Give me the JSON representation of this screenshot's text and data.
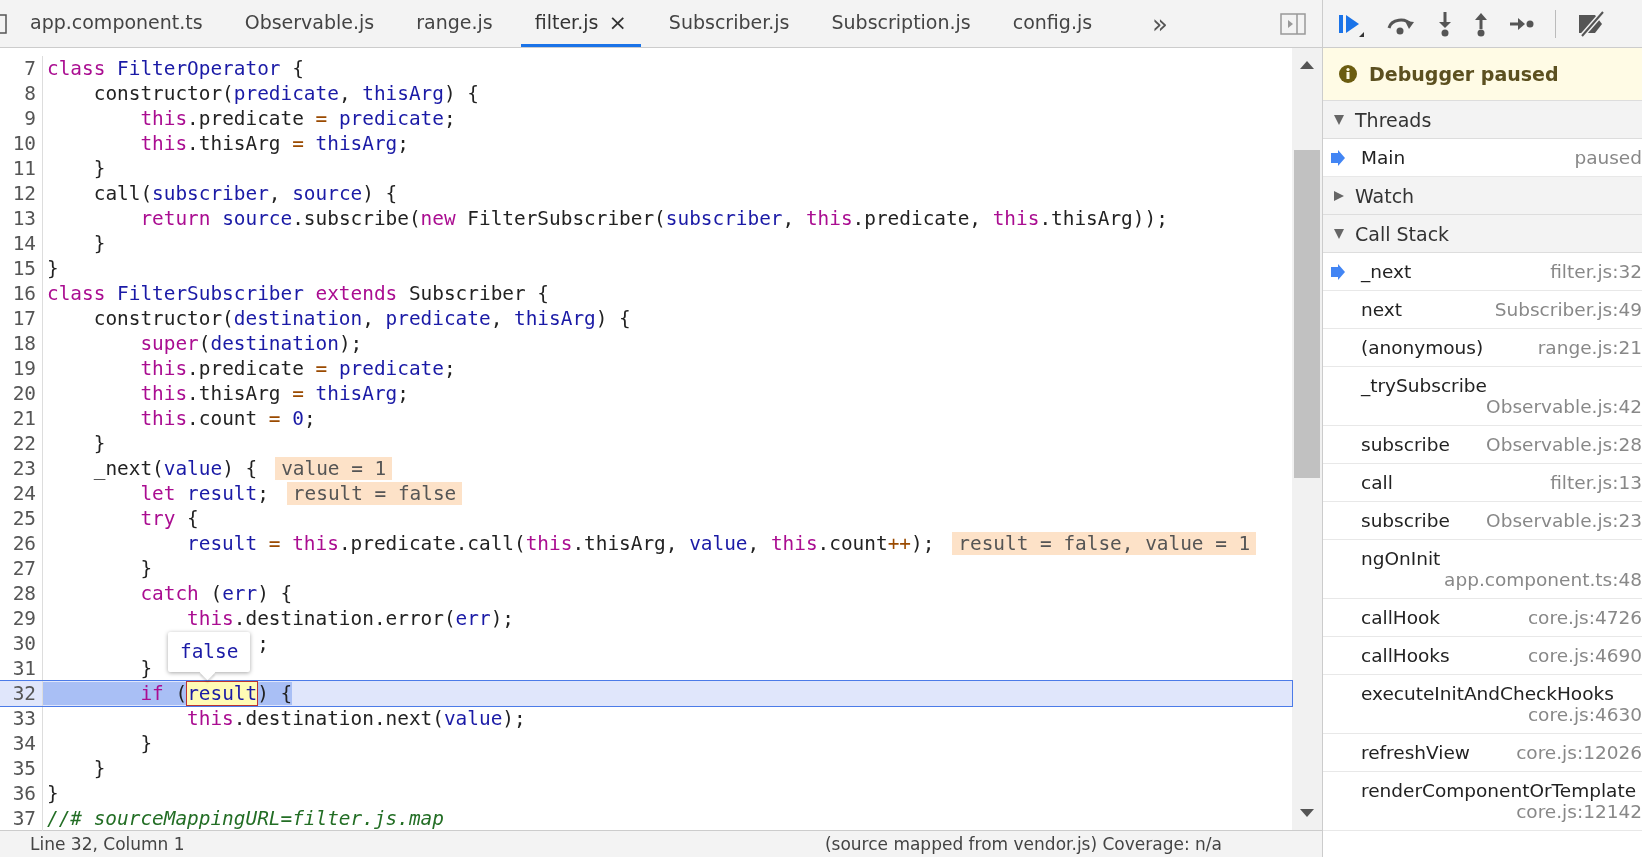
{
  "tabs": [
    {
      "label": "app.component.ts",
      "selected": false
    },
    {
      "label": "Observable.js",
      "selected": false
    },
    {
      "label": "range.js",
      "selected": false
    },
    {
      "label": "filter.js",
      "selected": true,
      "close": "×"
    },
    {
      "label": "Subscriber.js",
      "selected": false
    },
    {
      "label": "Subscription.js",
      "selected": false
    },
    {
      "label": "config.js",
      "selected": false
    }
  ],
  "more_tabs": "»",
  "code": {
    "lines": [
      {
        "number": "7",
        "paused": false,
        "tokens": [
          {
            "kind": "kw",
            "text": "class "
          },
          {
            "kind": "def",
            "text": "FilterOperator"
          },
          {
            "kind": "p",
            "text": " {"
          }
        ]
      },
      {
        "number": "8",
        "paused": false,
        "tokens": [
          {
            "kind": "p",
            "text": "    constructor("
          },
          {
            "kind": "v",
            "text": "predicate"
          },
          {
            "kind": "p",
            "text": ", "
          },
          {
            "kind": "v",
            "text": "thisArg"
          },
          {
            "kind": "p",
            "text": ") {"
          }
        ]
      },
      {
        "number": "9",
        "paused": false,
        "tokens": [
          {
            "kind": "kw",
            "text": "        this"
          },
          {
            "kind": "p",
            "text": ".predicate "
          },
          {
            "kind": "op",
            "text": "="
          },
          {
            "kind": "v",
            "text": " predicate"
          },
          {
            "kind": "p",
            "text": ";"
          }
        ]
      },
      {
        "number": "10",
        "paused": false,
        "tokens": [
          {
            "kind": "kw",
            "text": "        this"
          },
          {
            "kind": "p",
            "text": ".thisArg "
          },
          {
            "kind": "op",
            "text": "="
          },
          {
            "kind": "v",
            "text": " thisArg"
          },
          {
            "kind": "p",
            "text": ";"
          }
        ]
      },
      {
        "number": "11",
        "paused": false,
        "tokens": [
          {
            "kind": "p",
            "text": "    }"
          }
        ]
      },
      {
        "number": "12",
        "paused": false,
        "tokens": [
          {
            "kind": "p",
            "text": "    call("
          },
          {
            "kind": "v",
            "text": "subscriber"
          },
          {
            "kind": "p",
            "text": ", "
          },
          {
            "kind": "v",
            "text": "source"
          },
          {
            "kind": "p",
            "text": ") {"
          }
        ]
      },
      {
        "number": "13",
        "paused": false,
        "tokens": [
          {
            "kind": "kw",
            "text": "        return"
          },
          {
            "kind": "v",
            "text": " source"
          },
          {
            "kind": "p",
            "text": ".subscribe("
          },
          {
            "kind": "kw",
            "text": "new"
          },
          {
            "kind": "p",
            "text": " FilterSubscriber("
          },
          {
            "kind": "v",
            "text": "subscriber"
          },
          {
            "kind": "p",
            "text": ", "
          },
          {
            "kind": "kw",
            "text": "this"
          },
          {
            "kind": "p",
            "text": ".predicate, "
          },
          {
            "kind": "kw",
            "text": "this"
          },
          {
            "kind": "p",
            "text": ".thisArg));"
          }
        ]
      },
      {
        "number": "14",
        "paused": false,
        "tokens": [
          {
            "kind": "p",
            "text": "    }"
          }
        ]
      },
      {
        "number": "15",
        "paused": false,
        "tokens": [
          {
            "kind": "p",
            "text": "}"
          }
        ]
      },
      {
        "number": "16",
        "paused": false,
        "tokens": [
          {
            "kind": "kw",
            "text": "class "
          },
          {
            "kind": "def",
            "text": "FilterSubscriber"
          },
          {
            "kind": "kw",
            "text": " extends"
          },
          {
            "kind": "p",
            "text": " Subscriber {"
          }
        ]
      },
      {
        "number": "17",
        "paused": false,
        "tokens": [
          {
            "kind": "p",
            "text": "    constructor("
          },
          {
            "kind": "v",
            "text": "destination"
          },
          {
            "kind": "p",
            "text": ", "
          },
          {
            "kind": "v",
            "text": "predicate"
          },
          {
            "kind": "p",
            "text": ", "
          },
          {
            "kind": "v",
            "text": "thisArg"
          },
          {
            "kind": "p",
            "text": ") {"
          }
        ]
      },
      {
        "number": "18",
        "paused": false,
        "tokens": [
          {
            "kind": "kw",
            "text": "        super"
          },
          {
            "kind": "p",
            "text": "("
          },
          {
            "kind": "v",
            "text": "destination"
          },
          {
            "kind": "p",
            "text": ");"
          }
        ]
      },
      {
        "number": "19",
        "paused": false,
        "tokens": [
          {
            "kind": "kw",
            "text": "        this"
          },
          {
            "kind": "p",
            "text": ".predicate "
          },
          {
            "kind": "op",
            "text": "="
          },
          {
            "kind": "v",
            "text": " predicate"
          },
          {
            "kind": "p",
            "text": ";"
          }
        ]
      },
      {
        "number": "20",
        "paused": false,
        "tokens": [
          {
            "kind": "kw",
            "text": "        this"
          },
          {
            "kind": "p",
            "text": ".thisArg "
          },
          {
            "kind": "op",
            "text": "="
          },
          {
            "kind": "v",
            "text": " thisArg"
          },
          {
            "kind": "p",
            "text": ";"
          }
        ]
      },
      {
        "number": "21",
        "paused": false,
        "tokens": [
          {
            "kind": "kw",
            "text": "        this"
          },
          {
            "kind": "p",
            "text": ".count "
          },
          {
            "kind": "op",
            "text": "="
          },
          {
            "kind": "num",
            "text": " 0"
          },
          {
            "kind": "p",
            "text": ";"
          }
        ]
      },
      {
        "number": "22",
        "paused": false,
        "tokens": [
          {
            "kind": "p",
            "text": "    }"
          }
        ]
      },
      {
        "number": "23",
        "paused": false,
        "tokens": [
          {
            "kind": "p",
            "text": "    _next("
          },
          {
            "kind": "v",
            "text": "value"
          },
          {
            "kind": "p",
            "text": ") {"
          }
        ],
        "inline_value": "value = 1"
      },
      {
        "number": "24",
        "paused": false,
        "tokens": [
          {
            "kind": "kw",
            "text": "        let"
          },
          {
            "kind": "v",
            "text": " result"
          },
          {
            "kind": "p",
            "text": ";"
          }
        ],
        "inline_value": "result = false"
      },
      {
        "number": "25",
        "paused": false,
        "tokens": [
          {
            "kind": "kw",
            "text": "        try"
          },
          {
            "kind": "p",
            "text": " {"
          }
        ]
      },
      {
        "number": "26",
        "paused": false,
        "tokens": [
          {
            "kind": "v",
            "text": "            result "
          },
          {
            "kind": "op",
            "text": "="
          },
          {
            "kind": "kw",
            "text": " this"
          },
          {
            "kind": "p",
            "text": ".predicate.call("
          },
          {
            "kind": "kw",
            "text": "this"
          },
          {
            "kind": "p",
            "text": ".thisArg, "
          },
          {
            "kind": "v",
            "text": "value"
          },
          {
            "kind": "p",
            "text": ", "
          },
          {
            "kind": "kw",
            "text": "this"
          },
          {
            "kind": "p",
            "text": ".count"
          },
          {
            "kind": "op",
            "text": "++"
          },
          {
            "kind": "p",
            "text": ");"
          }
        ],
        "inline_value": "result = false, value = 1"
      },
      {
        "number": "27",
        "paused": false,
        "tokens": [
          {
            "kind": "p",
            "text": "        }"
          }
        ]
      },
      {
        "number": "28",
        "paused": false,
        "tokens": [
          {
            "kind": "kw",
            "text": "        catch"
          },
          {
            "kind": "p",
            "text": " ("
          },
          {
            "kind": "v",
            "text": "err"
          },
          {
            "kind": "p",
            "text": ") {"
          }
        ]
      },
      {
        "number": "29",
        "paused": false,
        "tokens": [
          {
            "kind": "kw",
            "text": "            this"
          },
          {
            "kind": "p",
            "text": ".destination.error("
          },
          {
            "kind": "v",
            "text": "err"
          },
          {
            "kind": "p",
            "text": ");"
          }
        ]
      },
      {
        "number": "30",
        "paused": false,
        "tokens": [
          {
            "kind": "p",
            "text": "                  ;"
          }
        ]
      },
      {
        "number": "31",
        "paused": false,
        "tokens": [
          {
            "kind": "p",
            "text": "        }"
          }
        ]
      },
      {
        "number": "32",
        "paused": true,
        "tokens": [
          {
            "kind": "kw",
            "text": "        if"
          },
          {
            "kind": "p",
            "text": " ("
          },
          {
            "kind": "hl",
            "text": "result"
          },
          {
            "kind": "p",
            "text": ") {"
          }
        ]
      },
      {
        "number": "33",
        "paused": false,
        "tokens": [
          {
            "kind": "kw",
            "text": "            this"
          },
          {
            "kind": "p",
            "text": ".destination.next("
          },
          {
            "kind": "v",
            "text": "value"
          },
          {
            "kind": "p",
            "text": ");"
          }
        ]
      },
      {
        "number": "34",
        "paused": false,
        "tokens": [
          {
            "kind": "p",
            "text": "        }"
          }
        ]
      },
      {
        "number": "35",
        "paused": false,
        "tokens": [
          {
            "kind": "p",
            "text": "    }"
          }
        ]
      },
      {
        "number": "36",
        "paused": false,
        "tokens": [
          {
            "kind": "p",
            "text": "}"
          }
        ]
      },
      {
        "number": "37",
        "paused": false,
        "tokens": [
          {
            "kind": "com",
            "text": "//# sourceMappingURL=filter.js.map"
          }
        ]
      }
    ],
    "tooltip": "false"
  },
  "status_bar": {
    "position": "Line 32, Column 1",
    "source": "(source mapped from vendor.js) Coverage: n/a"
  },
  "debugger": {
    "banner": "Debugger paused",
    "sections": [
      {
        "title": "Threads",
        "expanded": true
      },
      {
        "title": "Watch",
        "expanded": false
      },
      {
        "title": "Call Stack",
        "expanded": true
      }
    ],
    "threads": [
      {
        "name": "Main",
        "status": "paused",
        "selected": true
      }
    ],
    "call_stack": [
      {
        "name": "_next",
        "location": "filter.js:32",
        "selected": true
      },
      {
        "name": "next",
        "location": "Subscriber.js:49",
        "selected": false
      },
      {
        "name": "(anonymous)",
        "location": "range.js:21",
        "selected": false
      },
      {
        "name": "_trySubscribe",
        "location": "Observable.js:42",
        "selected": false
      },
      {
        "name": "subscribe",
        "location": "Observable.js:28",
        "selected": false
      },
      {
        "name": "call",
        "location": "filter.js:13",
        "selected": false
      },
      {
        "name": "subscribe",
        "location": "Observable.js:23",
        "selected": false
      },
      {
        "name": "ngOnInit",
        "location": "app.component.ts:48",
        "selected": false
      },
      {
        "name": "callHook",
        "location": "core.js:4726",
        "selected": false
      },
      {
        "name": "callHooks",
        "location": "core.js:4690",
        "selected": false
      },
      {
        "name": "executeInitAndCheckHooks",
        "location": "core.js:4630",
        "selected": false
      },
      {
        "name": "refreshView",
        "location": "core.js:12026",
        "selected": false
      },
      {
        "name": "renderComponentOrTemplate",
        "location": "core.js:12142",
        "selected": false
      }
    ]
  }
}
